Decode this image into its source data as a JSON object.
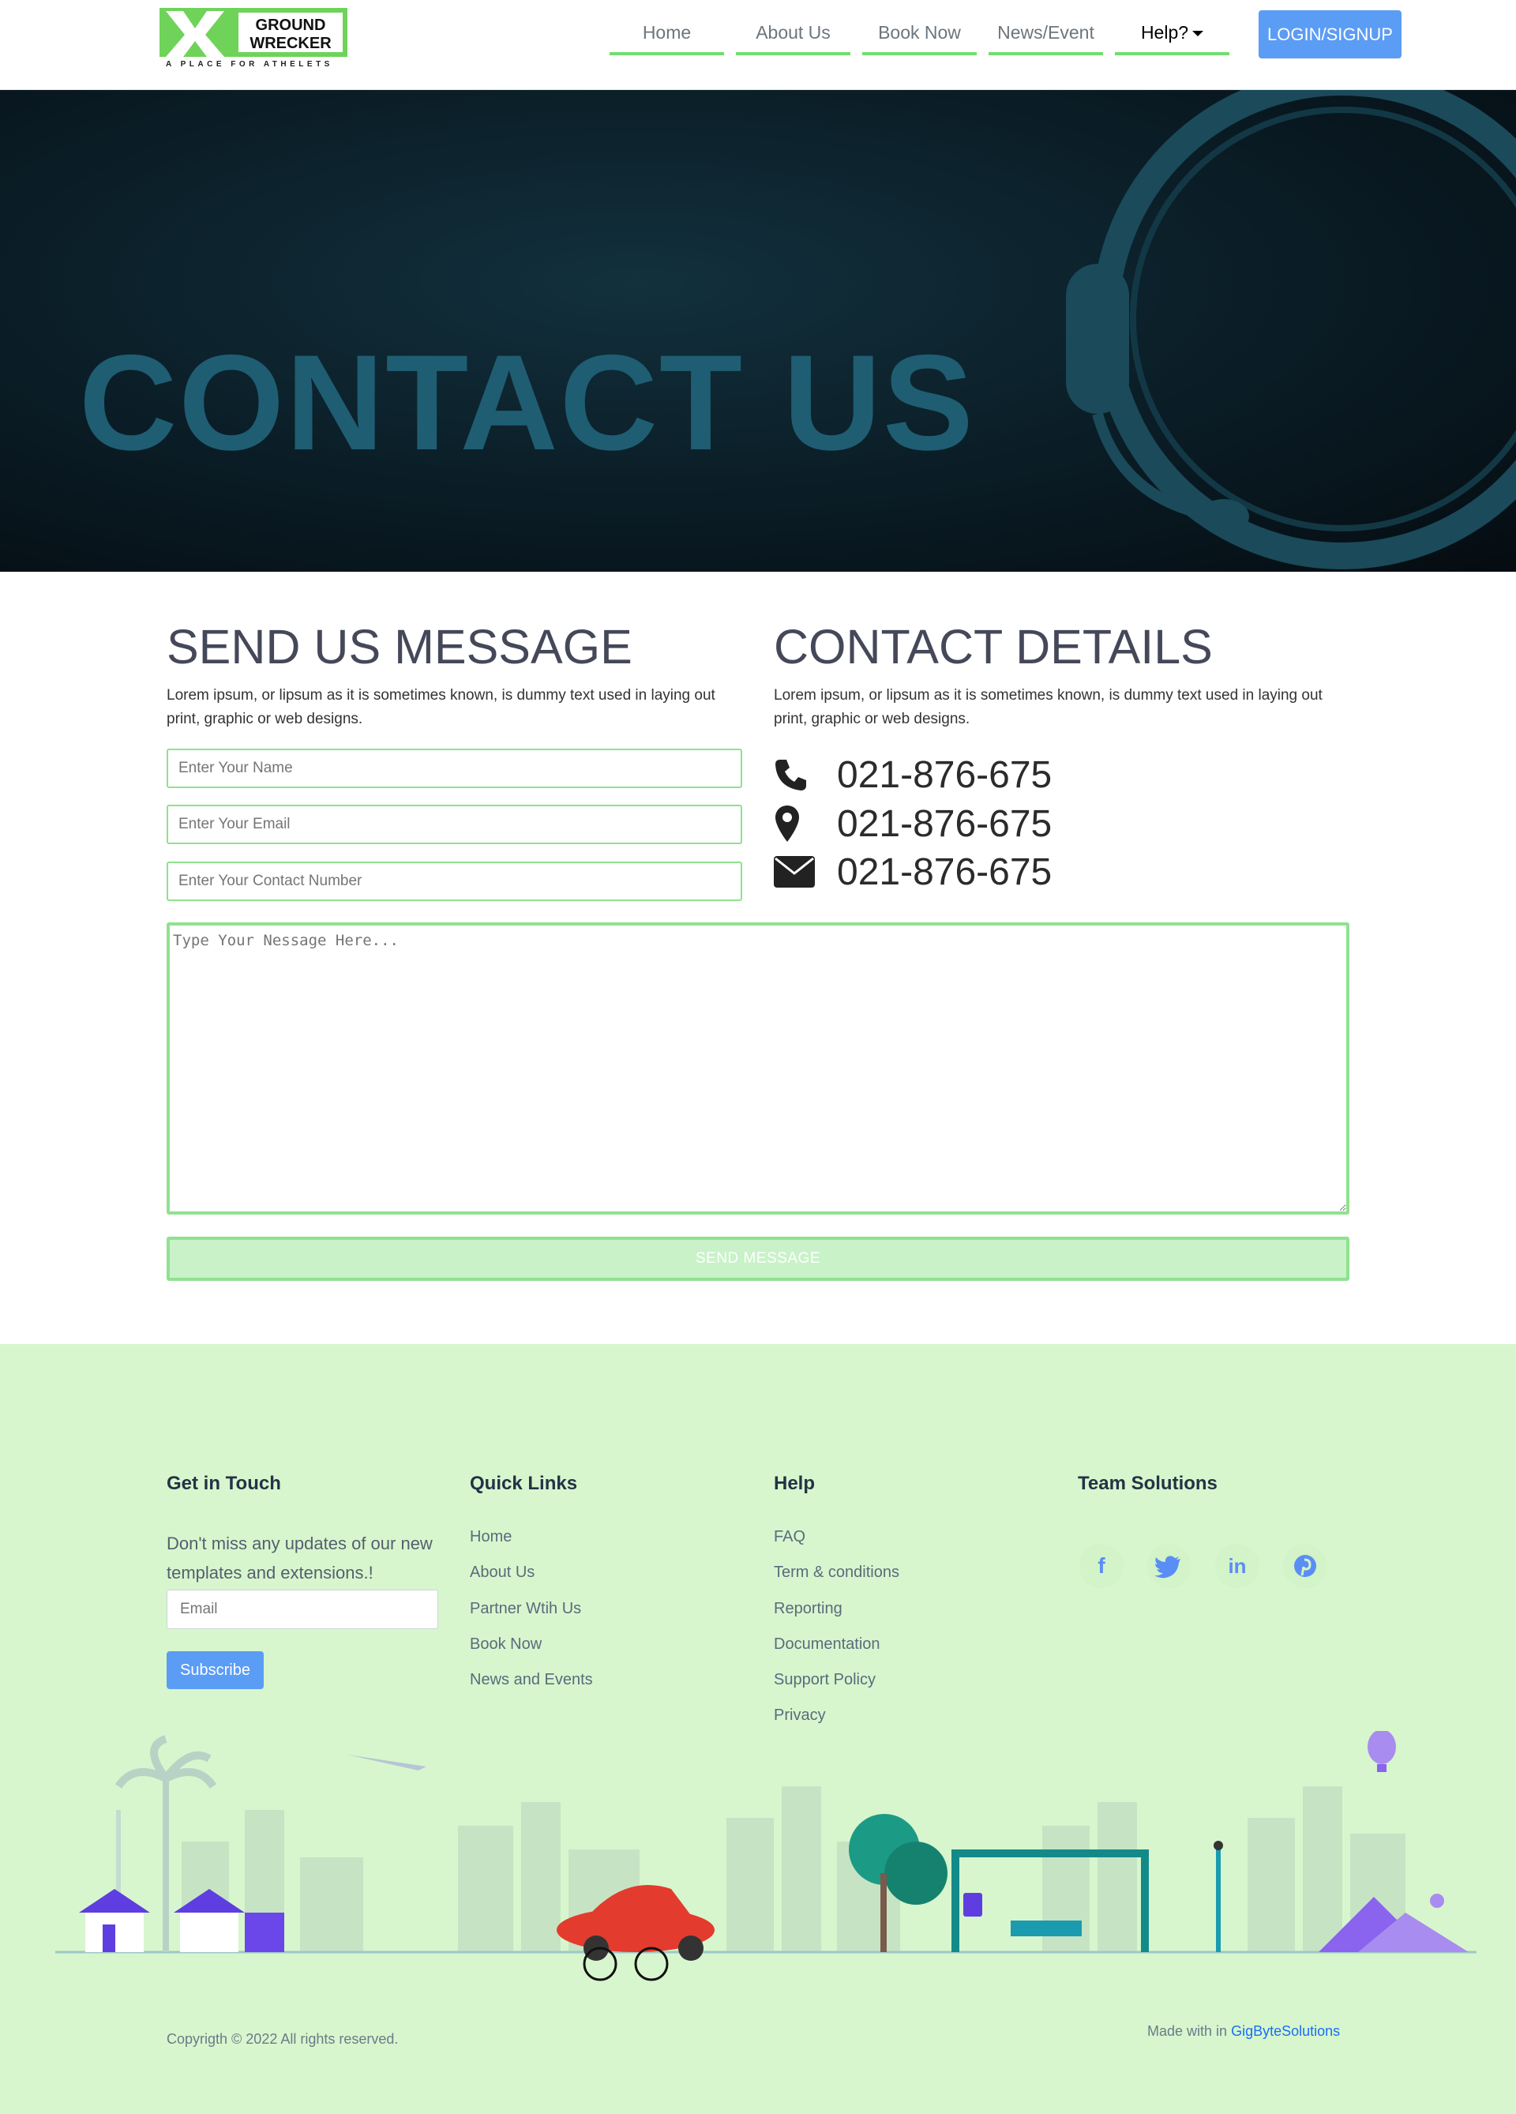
{
  "nav": {
    "logo_text_line1": "GROUND",
    "logo_text_line2": "WRECKER",
    "logo_tagline": "A PLACE FOR ATHELETS",
    "links": [
      "Home",
      "About Us",
      "Book Now",
      "News/Event",
      "Help?"
    ],
    "login_label": "LOGIN/SIGNUP",
    "accent_color": "#72dd72",
    "button_color": "#5b9cf5"
  },
  "hero": {
    "title": "CONTACT US"
  },
  "send": {
    "title": "SEND US MESSAGE",
    "text": "Lorem ipsum, or lipsum as it is sometimes known, is dummy text used in laying out print, graphic or web designs.",
    "name_placeholder": "Enter Your Name",
    "email_placeholder": "Enter Your Email",
    "contact_placeholder": "Enter Your Contact Number",
    "message_placeholder": "Type Your Nessage Here...",
    "button_label": "SEND MESSAGE"
  },
  "details": {
    "title": "CONTACT DETAILS",
    "text": "Lorem ipsum, or lipsum as it is sometimes known, is dummy text used in laying out print, graphic or web designs.",
    "rows": [
      {
        "icon": "phone-icon",
        "value": "021-876-675"
      },
      {
        "icon": "map-marker-icon",
        "value": "021-876-675"
      },
      {
        "icon": "envelope-icon",
        "value": "021-876-675"
      }
    ]
  },
  "footer": {
    "bg_color": "#d7f6cd",
    "get_in_touch": {
      "title": "Get in Touch",
      "text": "Don't miss any updates of our new templates and extensions.!",
      "email_placeholder": "Email",
      "button_label": "Subscribe"
    },
    "quick_links": {
      "title": "Quick Links",
      "items": [
        "Home",
        "About Us",
        "Partner Wtih Us",
        "Book Now",
        "News and Events"
      ]
    },
    "help": {
      "title": "Help",
      "items": [
        "FAQ",
        "Term & conditions",
        "Reporting",
        "Documentation",
        "Support Policy",
        "Privacy"
      ]
    },
    "team": {
      "title": "Team Solutions",
      "social": [
        "facebook-icon",
        "twitter-icon",
        "linkedin-icon",
        "pinterest-icon"
      ]
    },
    "copyright": "Copyrigth © 2022 All rights reserved.",
    "made_with": "Made with in",
    "made_by": "GigByteSolutions"
  }
}
